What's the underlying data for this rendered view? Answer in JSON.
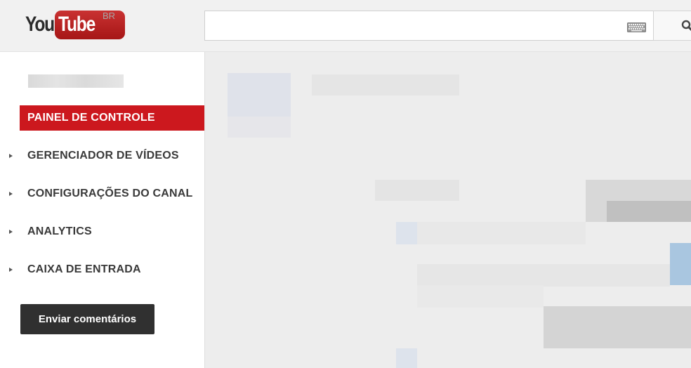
{
  "header": {
    "logo": {
      "you": "You",
      "tube": "Tube",
      "region": "BR"
    },
    "search": {
      "value": "",
      "placeholder": ""
    },
    "icons": {
      "keyboard": "keyboard-icon",
      "search": "search-icon"
    }
  },
  "sidebar": {
    "items": [
      {
        "label": "PAINEL DE CONTROLE",
        "active": true
      },
      {
        "label": "GERENCIADOR DE VÍDEOS",
        "active": false
      },
      {
        "label": "CONFIGURAÇÕES DO CANAL",
        "active": false
      },
      {
        "label": "ANALYTICS",
        "active": false
      },
      {
        "label": "CAIXA DE ENTRADA",
        "active": false
      }
    ],
    "feedback_label": "Enviar comentários"
  },
  "colors": {
    "accent": "#cc181e",
    "button_dark": "#303030"
  }
}
